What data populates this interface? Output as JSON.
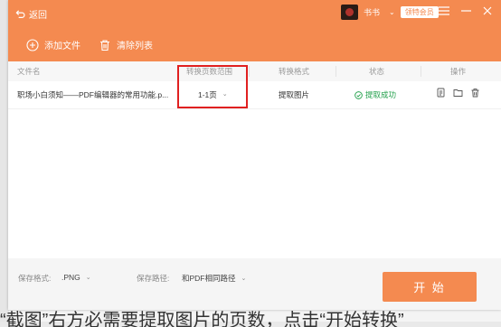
{
  "header": {
    "back_label": "返回",
    "user_name": "书书",
    "vip_label": "领特会员"
  },
  "toolbar": {
    "add_files": "添加文件",
    "clear_list": "清除列表"
  },
  "table": {
    "columns": [
      "文件名",
      "转换页数范围",
      "转换格式",
      "状态",
      "操作"
    ],
    "rows": [
      {
        "file_name": "职场小白须知——PDF编辑器的常用功能.p...",
        "page_range": "1-1页",
        "format": "提取图片",
        "status": "提取成功"
      }
    ]
  },
  "footer": {
    "save_format_label": "保存格式:",
    "save_format_value": ".PNG",
    "save_path_label": "保存路径:",
    "save_path_value": "和PDF相同路径",
    "start_button": "开 始"
  },
  "background": {
    "bottom_text": "“截图”右方必需要提取图片的页数，点击“开始转换”"
  },
  "colors": {
    "accent": "#f48a50",
    "success": "#22a04b",
    "highlight": "#e02020"
  }
}
